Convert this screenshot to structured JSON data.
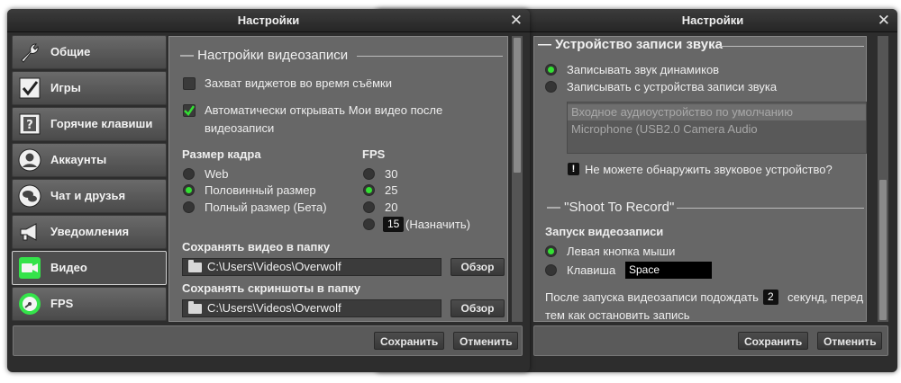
{
  "left_window": {
    "title": "Настройки",
    "sidebar": [
      {
        "label": "Общие",
        "icon": "wrench-icon"
      },
      {
        "label": "Игры",
        "icon": "checkbox-icon"
      },
      {
        "label": "Горячие клавиши",
        "icon": "question-key-icon"
      },
      {
        "label": "Аккаунты",
        "icon": "user-icon"
      },
      {
        "label": "Чат и друзья",
        "icon": "chat-icon"
      },
      {
        "label": "Уведомления",
        "icon": "megaphone-icon"
      },
      {
        "label": "Видео",
        "icon": "camera-icon",
        "active": true,
        "accent": "#34e34a"
      },
      {
        "label": "FPS",
        "icon": "gauge-icon",
        "accent": "#34e34a"
      }
    ],
    "content": {
      "section_title": "— Настройки видеозаписи",
      "capture_widgets": {
        "label": "Захват виджетов во время съёмки",
        "checked": false
      },
      "auto_open": {
        "label_line1": "Автоматически открывать Мои видео после",
        "label_line2": "видеозаписи",
        "checked": true
      },
      "frame_size": {
        "title": "Размер кадра",
        "options": [
          "Web",
          "Половинный размер",
          "Полный размер (Бета)"
        ],
        "selected": 1
      },
      "fps": {
        "title": "FPS",
        "options": [
          "30",
          "25",
          "20"
        ],
        "selected": 1,
        "custom_value": "15",
        "custom_label": "(Назначить)"
      },
      "save_video": {
        "label": "Сохранять видео в папку",
        "path": "C:\\Users\\Videos\\Overwolf",
        "button": "Обзор"
      },
      "save_screens": {
        "label": "Сохранять скриншоты в папку",
        "path": "C:\\Users\\Videos\\Overwolf",
        "button": "Обзор"
      }
    },
    "footer": {
      "save": "Сохранить",
      "cancel": "Отменить"
    }
  },
  "right_window": {
    "title": "Настройки",
    "content": {
      "section_title": "— Устройство записи звука",
      "record_speakers": "Записывать звук динамиков",
      "record_device": "Записывать с устройства записи звука",
      "selected": 0,
      "devices": [
        "Входное аудиоустройство по умолчанию",
        "Microphone (USB2.0 Camera Audio"
      ],
      "warning": "Не можете обнаружить звуковое устройство?",
      "shoot_title": "— \"Shoot To Record\"",
      "start_title": "Запуск видеозаписи",
      "left_mouse": "Левая кнопка мыши",
      "key_label": "Клавиша",
      "key_value": "Space",
      "trigger_selected": 0,
      "wait_text_a": "После запуска видеозаписи подождать",
      "wait_value": "2",
      "wait_text_b": "секунд, перед",
      "wait_text_c": "тем как остановить запись"
    },
    "footer": {
      "save": "Сохранить",
      "cancel": "Отменить"
    }
  },
  "colors": {
    "accent_green": "#33e033",
    "panel": "#676767",
    "frame": "#2d2d2d"
  }
}
